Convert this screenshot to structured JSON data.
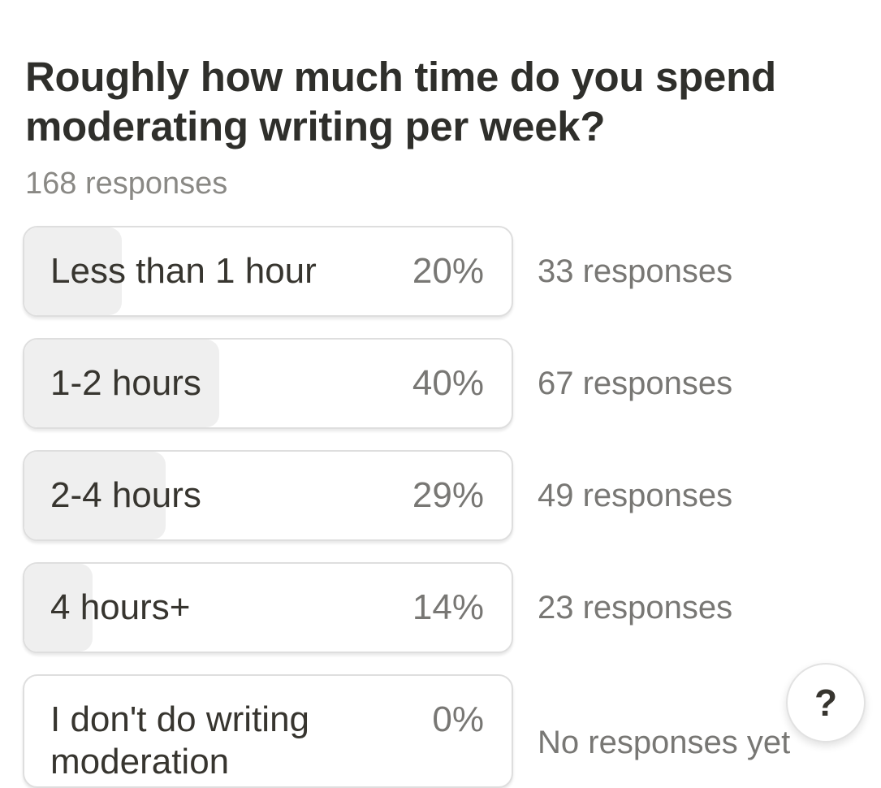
{
  "poll": {
    "question": "Roughly how much time do you spend moderating writing per week?",
    "total_responses": "168 responses",
    "options": [
      {
        "label": "Less than 1 hour",
        "percent": "20%",
        "fill": 0.2,
        "responses": "33 responses"
      },
      {
        "label": "1-2 hours",
        "percent": "40%",
        "fill": 0.4,
        "responses": "67 responses"
      },
      {
        "label": "2-4 hours",
        "percent": "29%",
        "fill": 0.29,
        "responses": "49 responses"
      },
      {
        "label": "4 hours+",
        "percent": "14%",
        "fill": 0.14,
        "responses": "23 responses"
      },
      {
        "label": "I don't do writing moderation",
        "percent": "0%",
        "fill": 0,
        "responses": "No responses yet"
      }
    ]
  },
  "help": {
    "icon": "question-mark-icon",
    "symbol": "?"
  },
  "colors": {
    "fill": "#efefef",
    "border": "#dedede",
    "text": "#37352f",
    "muted": "#787774"
  }
}
